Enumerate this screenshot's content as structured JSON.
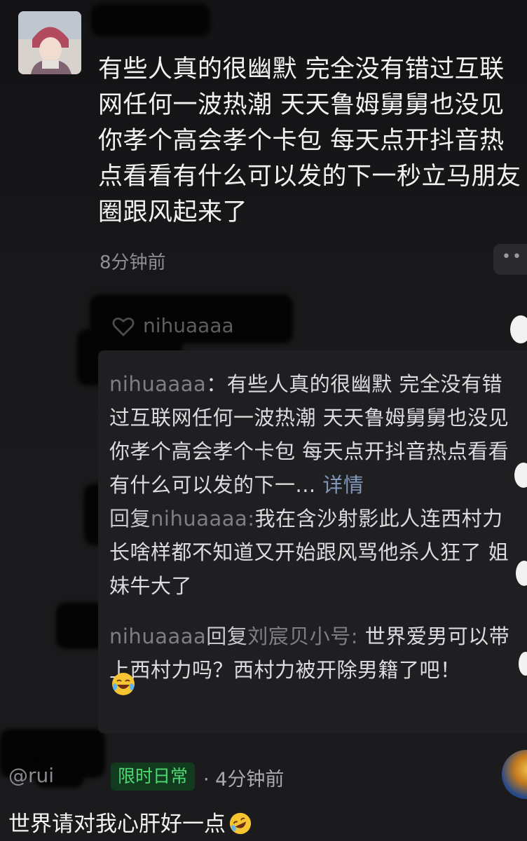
{
  "post": {
    "text": "有些人真的很幽默 完全没有错过互联网任何一波热潮 天天鲁姆舅舅也没见你孝个高会孝个卡包 每天点开抖音热点看看有什么可以发的下一秒立马朋友圈跟风起来了",
    "time": "8分钟前"
  },
  "likes": {
    "name": "nihuaaaa"
  },
  "quote": {
    "author": "nihuaaaa",
    "text": "有些人真的很幽默 完全没有错过互联网任何一波热潮 天天鲁姆舅舅也没见你孝个高会孝个卡包 每天点开抖音热点看看有什么可以发的下一...",
    "detail": "详情"
  },
  "replies": [
    {
      "verb": "回复",
      "target": "nihuaaaa:",
      "text": "我在含沙射影此人连西村力长啥样都不知道又开始跟风骂他杀人狂了 姐妹牛大了"
    },
    {
      "author": "nihuaaaa",
      "verb": "回复",
      "target": "刘宸贝小号:",
      "text": "世界爱男可以带上西村力吗？西村力被开除男籍了吧！"
    }
  ],
  "bottom": {
    "username": "@rui",
    "tag": "限时日常",
    "time": "· 4分钟前",
    "comment": "世界请对我心肝好一点"
  },
  "icons": {
    "heart": "heart-outline-icon",
    "laugh": "tears-of-joy-emoji",
    "rofl": "rolling-laughing-emoji",
    "more": "more-dots-icon"
  },
  "colors": {
    "background": "#161618",
    "tag_bg": "#113a1e",
    "tag_text": "#4cd971",
    "link": "#7f97b8"
  }
}
